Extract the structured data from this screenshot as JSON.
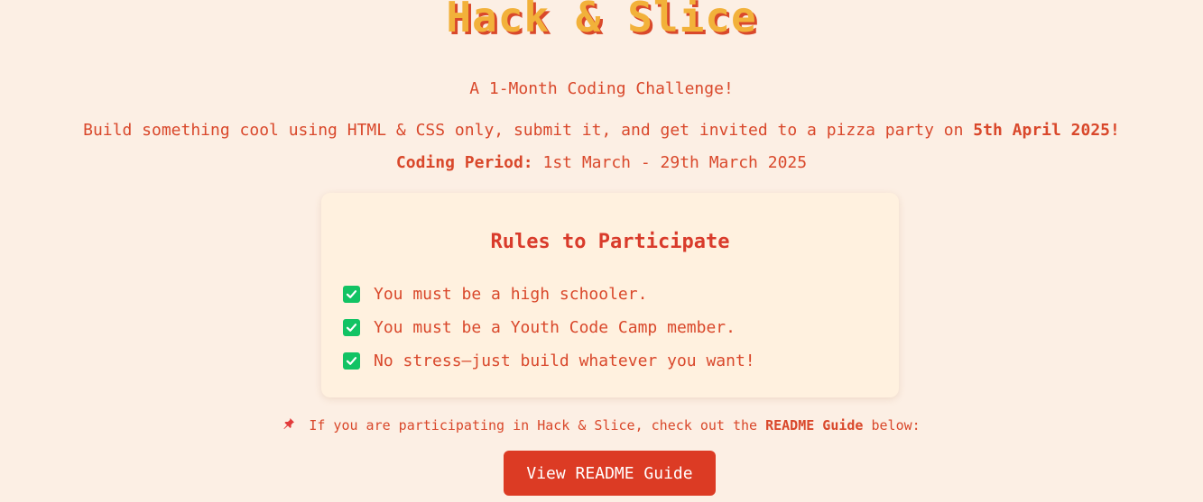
{
  "header": {
    "title": "Hack & Slice",
    "tagline": "A 1-Month Coding Challenge!",
    "description_text": "Build something cool using HTML & CSS only, submit it, and get invited to a pizza party on ",
    "description_date": "5th April 2025!",
    "period_label": "Coding Period:",
    "period_value": " 1st March - 29th March 2025"
  },
  "rules_card": {
    "title": "Rules to Participate",
    "items": [
      {
        "icon": "check-box-icon",
        "text": "You must be a high schooler."
      },
      {
        "icon": "check-box-icon",
        "text": "You must be a Youth Code Camp member."
      },
      {
        "icon": "check-box-icon",
        "text": "No stress—just build whatever you want!"
      }
    ]
  },
  "readme_note": {
    "icon": "pushpin-icon",
    "text_before": " If you are participating in Hack & Slice, check out the ",
    "highlight": "README Guide",
    "text_after": " below:"
  },
  "readme_button": {
    "label": "View README Guide"
  },
  "colors": {
    "background": "#fcefe4",
    "text": "#d9482b",
    "title_fill": "#f2b13a",
    "card_bg": "#fff1df",
    "check": "#12c364",
    "button": "#dc3b24"
  }
}
